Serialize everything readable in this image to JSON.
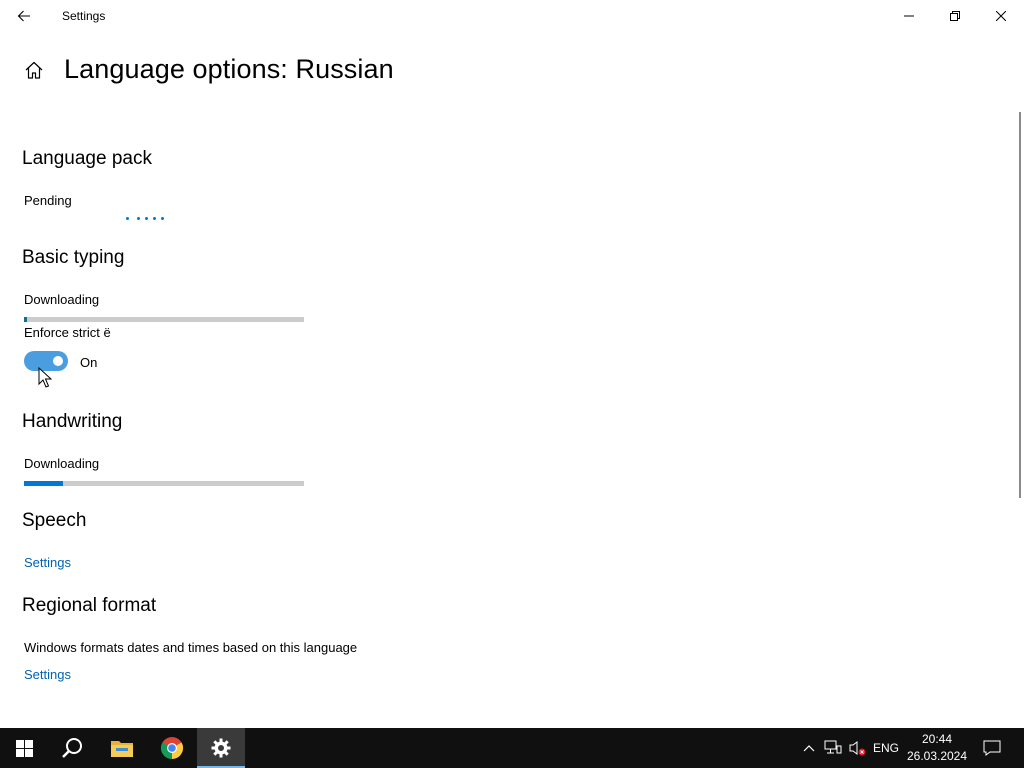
{
  "window": {
    "title": "Settings"
  },
  "page": {
    "title": "Language options: Russian"
  },
  "language_pack": {
    "heading": "Language pack",
    "status": "Pending"
  },
  "basic_typing": {
    "heading": "Basic typing",
    "status": "Downloading",
    "progress": 0.01,
    "enforce_label": "Enforce strict ë",
    "toggle_state": "On"
  },
  "handwriting": {
    "heading": "Handwriting",
    "status": "Downloading",
    "progress": 0.14
  },
  "speech": {
    "heading": "Speech",
    "settings_link": "Settings"
  },
  "regional_format": {
    "heading": "Regional format",
    "description": "Windows formats dates and times based on this language",
    "settings_link": "Settings"
  },
  "taskbar": {
    "language": "ENG",
    "time": "20:44",
    "date": "26.03.2024"
  },
  "colors": {
    "accent": "#0078d7",
    "link": "#0063b1",
    "toggle_on": "#4a9ee0",
    "taskbar": "#101010"
  }
}
